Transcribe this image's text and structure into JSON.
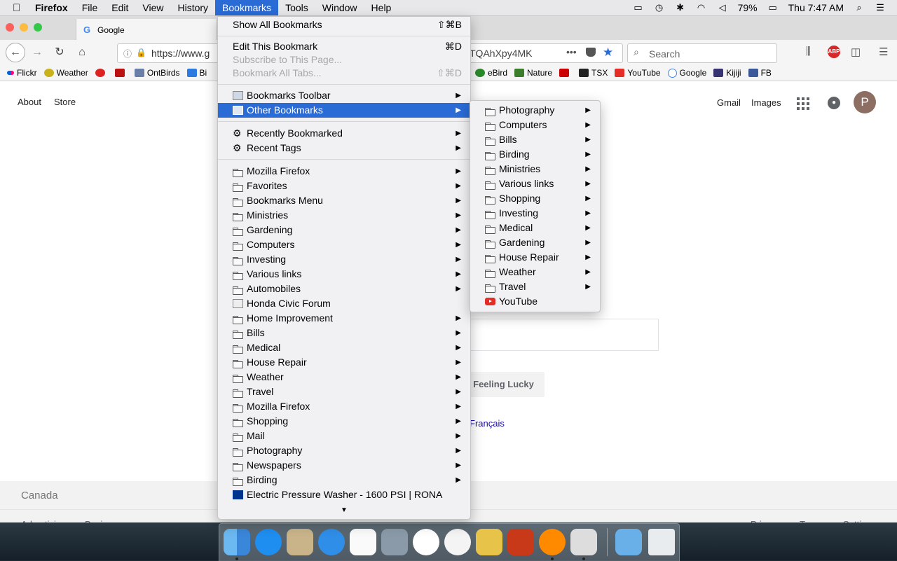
{
  "menubar": {
    "apple": "",
    "items": [
      "Firefox",
      "File",
      "Edit",
      "View",
      "History",
      "Bookmarks",
      "Tools",
      "Window",
      "Help"
    ],
    "status": {
      "battery": "79%",
      "clock": "Thu 7:47 AM"
    }
  },
  "browser": {
    "tab_title": "Google",
    "url": "https://www.g",
    "url_tail": "TQAhXpy4MK",
    "search_placeholder": "Search",
    "bookmarks_bar": [
      "Flickr",
      "Weather",
      "",
      "",
      "OntBirds",
      "Bi"
    ],
    "bookmarks_bar_right": [
      "eBird",
      "Nature",
      "",
      "TSX",
      "YouTube",
      "Google",
      "Kijiji",
      "FB"
    ]
  },
  "google": {
    "top_left": [
      "About",
      "Store"
    ],
    "top_right": [
      "Gmail",
      "Images"
    ],
    "avatar": "P",
    "lucky_button": "Feeling Lucky",
    "language_link": "Français",
    "country": "Canada",
    "footer_left": [
      "Advertising",
      "Business"
    ],
    "footer_right": [
      "Privacy",
      "Terms",
      "Settings"
    ]
  },
  "bookmarks_menu": {
    "top": [
      {
        "label": "Show All Bookmarks",
        "shortcut": "⇧⌘B",
        "disabled": false
      },
      {
        "label": "Edit This Bookmark",
        "shortcut": "⌘D",
        "disabled": false
      },
      {
        "label": "Subscribe to This Page...",
        "shortcut": "",
        "disabled": true
      },
      {
        "label": "Bookmark All Tabs...",
        "shortcut": "⇧⌘D",
        "disabled": true
      }
    ],
    "toolbar_item": "Bookmarks Toolbar",
    "other_item": "Other Bookmarks",
    "recent": [
      "Recently Bookmarked",
      "Recent Tags"
    ],
    "folders": [
      "Mozilla Firefox",
      "Favorites",
      "Bookmarks Menu",
      "Ministries",
      "Gardening",
      "Computers",
      "Investing",
      "Various links",
      "Automobiles",
      "Honda Civic Forum",
      "Home Improvement",
      "Bills",
      "Medical",
      "House Repair",
      "Weather",
      "Travel",
      "Mozilla Firefox",
      "Shopping",
      "Mail",
      "Photography",
      "Newspapers",
      "Birding",
      "Electric Pressure Washer - 1600 PSI | RONA"
    ]
  },
  "other_bookmarks_submenu": [
    "Photography",
    "Computers",
    "Bills",
    "Birding",
    "Ministries",
    "Various links",
    "Shopping",
    "Investing",
    "Medical",
    "Gardening",
    "House Repair",
    "Weather",
    "Travel",
    "YouTube"
  ],
  "colors": {
    "highlight": "#2a6bd6",
    "menu_bg": "#f1f1f3"
  }
}
